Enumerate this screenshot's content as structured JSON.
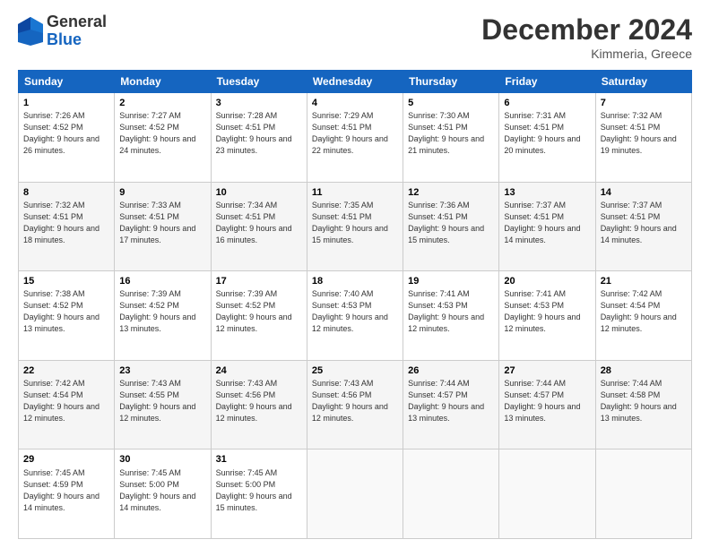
{
  "header": {
    "logo": {
      "line1": "General",
      "line2": "Blue"
    },
    "title": "December 2024",
    "subtitle": "Kimmeria, Greece"
  },
  "calendar": {
    "days_of_week": [
      "Sunday",
      "Monday",
      "Tuesday",
      "Wednesday",
      "Thursday",
      "Friday",
      "Saturday"
    ],
    "weeks": [
      [
        {
          "day": "1",
          "sunrise": "7:26 AM",
          "sunset": "4:52 PM",
          "daylight": "9 hours and 26 minutes."
        },
        {
          "day": "2",
          "sunrise": "7:27 AM",
          "sunset": "4:52 PM",
          "daylight": "9 hours and 24 minutes."
        },
        {
          "day": "3",
          "sunrise": "7:28 AM",
          "sunset": "4:51 PM",
          "daylight": "9 hours and 23 minutes."
        },
        {
          "day": "4",
          "sunrise": "7:29 AM",
          "sunset": "4:51 PM",
          "daylight": "9 hours and 22 minutes."
        },
        {
          "day": "5",
          "sunrise": "7:30 AM",
          "sunset": "4:51 PM",
          "daylight": "9 hours and 21 minutes."
        },
        {
          "day": "6",
          "sunrise": "7:31 AM",
          "sunset": "4:51 PM",
          "daylight": "9 hours and 20 minutes."
        },
        {
          "day": "7",
          "sunrise": "7:32 AM",
          "sunset": "4:51 PM",
          "daylight": "9 hours and 19 minutes."
        }
      ],
      [
        {
          "day": "8",
          "sunrise": "7:32 AM",
          "sunset": "4:51 PM",
          "daylight": "9 hours and 18 minutes."
        },
        {
          "day": "9",
          "sunrise": "7:33 AM",
          "sunset": "4:51 PM",
          "daylight": "9 hours and 17 minutes."
        },
        {
          "day": "10",
          "sunrise": "7:34 AM",
          "sunset": "4:51 PM",
          "daylight": "9 hours and 16 minutes."
        },
        {
          "day": "11",
          "sunrise": "7:35 AM",
          "sunset": "4:51 PM",
          "daylight": "9 hours and 15 minutes."
        },
        {
          "day": "12",
          "sunrise": "7:36 AM",
          "sunset": "4:51 PM",
          "daylight": "9 hours and 15 minutes."
        },
        {
          "day": "13",
          "sunrise": "7:37 AM",
          "sunset": "4:51 PM",
          "daylight": "9 hours and 14 minutes."
        },
        {
          "day": "14",
          "sunrise": "7:37 AM",
          "sunset": "4:51 PM",
          "daylight": "9 hours and 14 minutes."
        }
      ],
      [
        {
          "day": "15",
          "sunrise": "7:38 AM",
          "sunset": "4:52 PM",
          "daylight": "9 hours and 13 minutes."
        },
        {
          "day": "16",
          "sunrise": "7:39 AM",
          "sunset": "4:52 PM",
          "daylight": "9 hours and 13 minutes."
        },
        {
          "day": "17",
          "sunrise": "7:39 AM",
          "sunset": "4:52 PM",
          "daylight": "9 hours and 12 minutes."
        },
        {
          "day": "18",
          "sunrise": "7:40 AM",
          "sunset": "4:53 PM",
          "daylight": "9 hours and 12 minutes."
        },
        {
          "day": "19",
          "sunrise": "7:41 AM",
          "sunset": "4:53 PM",
          "daylight": "9 hours and 12 minutes."
        },
        {
          "day": "20",
          "sunrise": "7:41 AM",
          "sunset": "4:53 PM",
          "daylight": "9 hours and 12 minutes."
        },
        {
          "day": "21",
          "sunrise": "7:42 AM",
          "sunset": "4:54 PM",
          "daylight": "9 hours and 12 minutes."
        }
      ],
      [
        {
          "day": "22",
          "sunrise": "7:42 AM",
          "sunset": "4:54 PM",
          "daylight": "9 hours and 12 minutes."
        },
        {
          "day": "23",
          "sunrise": "7:43 AM",
          "sunset": "4:55 PM",
          "daylight": "9 hours and 12 minutes."
        },
        {
          "day": "24",
          "sunrise": "7:43 AM",
          "sunset": "4:56 PM",
          "daylight": "9 hours and 12 minutes."
        },
        {
          "day": "25",
          "sunrise": "7:43 AM",
          "sunset": "4:56 PM",
          "daylight": "9 hours and 12 minutes."
        },
        {
          "day": "26",
          "sunrise": "7:44 AM",
          "sunset": "4:57 PM",
          "daylight": "9 hours and 13 minutes."
        },
        {
          "day": "27",
          "sunrise": "7:44 AM",
          "sunset": "4:57 PM",
          "daylight": "9 hours and 13 minutes."
        },
        {
          "day": "28",
          "sunrise": "7:44 AM",
          "sunset": "4:58 PM",
          "daylight": "9 hours and 13 minutes."
        }
      ],
      [
        {
          "day": "29",
          "sunrise": "7:45 AM",
          "sunset": "4:59 PM",
          "daylight": "9 hours and 14 minutes."
        },
        {
          "day": "30",
          "sunrise": "7:45 AM",
          "sunset": "5:00 PM",
          "daylight": "9 hours and 14 minutes."
        },
        {
          "day": "31",
          "sunrise": "7:45 AM",
          "sunset": "5:00 PM",
          "daylight": "9 hours and 15 minutes."
        },
        null,
        null,
        null,
        null
      ]
    ]
  }
}
